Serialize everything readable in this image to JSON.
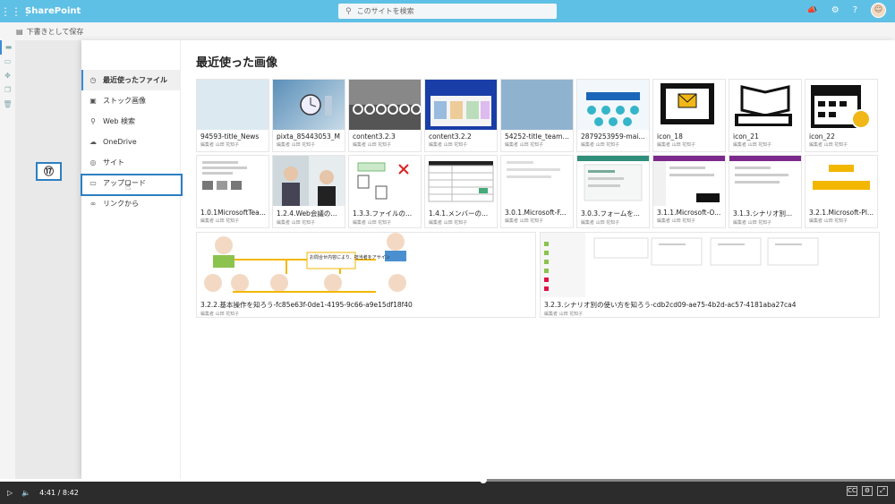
{
  "topbar": {
    "brand": "SharePoint",
    "search_placeholder": "このサイトを検索"
  },
  "cmdbar": {
    "save_draft": "下書きとして保存"
  },
  "panel": {
    "title": "最近使った画像",
    "nav": [
      {
        "label": "最近使ったファイル",
        "icon": "clock-icon"
      },
      {
        "label": "ストック画像",
        "icon": "image-icon"
      },
      {
        "label": "Web 検索",
        "icon": "search-icon"
      },
      {
        "label": "OneDrive",
        "icon": "cloud-icon"
      },
      {
        "label": "サイト",
        "icon": "globe-icon"
      },
      {
        "label": "アップロード",
        "icon": "laptop-icon"
      },
      {
        "label": "リンクから",
        "icon": "link-icon"
      }
    ],
    "callout": "⑰"
  },
  "cards": [
    {
      "name": "94593-title_News",
      "sub": "編集者 山田 花知子"
    },
    {
      "name": "pixta_85443053_M",
      "sub": "編集者 山田 花知子"
    },
    {
      "name": "content3.2.3",
      "sub": "編集者 山田 花知子"
    },
    {
      "name": "content3.2.2",
      "sub": "編集者 山田 花知子"
    },
    {
      "name": "54252-title_teams...",
      "sub": "編集者 山田 花知子"
    },
    {
      "name": "2879253959-mai...",
      "sub": "編集者 山田 花知子"
    },
    {
      "name": "icon_18",
      "sub": "編集者 山田 花知子"
    },
    {
      "name": "icon_21",
      "sub": "編集者 山田 花知子"
    },
    {
      "name": "icon_22",
      "sub": "編集者 山田 花知子"
    },
    {
      "name": "1.0.1MicrosoftTea...",
      "sub": "編集者 山田 花知子"
    },
    {
      "name": "1.2.4.Web会議の...",
      "sub": "編集者 山田 花知子"
    },
    {
      "name": "1.3.3.ファイルの...",
      "sub": "編集者 山田 花知子"
    },
    {
      "name": "1.4.1.メンバーの...",
      "sub": "編集者 山田 花知子"
    },
    {
      "name": "3.0.1.Microsoft-F...",
      "sub": "編集者 山田 花知子"
    },
    {
      "name": "3.0.3.フォームを...",
      "sub": "編集者 山田 花知子"
    },
    {
      "name": "3.1.1.Microsoft-O...",
      "sub": "編集者 山田 花知子"
    },
    {
      "name": "3.1.3.シナリオ別...",
      "sub": "編集者 山田 花知子"
    },
    {
      "name": "3.2.1.Microsoft-Pl...",
      "sub": "編集者 山田 花知子"
    },
    {
      "name": "3.2.2.基本操作を知ろう-fc85e63f-0de1-4195-9c66-a9e15df18f40",
      "sub": "編集者 山田 花知子"
    },
    {
      "name": "3.2.3.シナリオ別の使い方を知ろう-cdb2cd09-ae75-4b2d-ac57-4181aba27ca4",
      "sub": "編集者 山田 花知子"
    }
  ],
  "wide_thumb_text": "お問合せ内容により、担当者をアサイン",
  "video": {
    "current": "4:41",
    "total": "8:42",
    "progress": 0.54,
    "sep": "/"
  }
}
